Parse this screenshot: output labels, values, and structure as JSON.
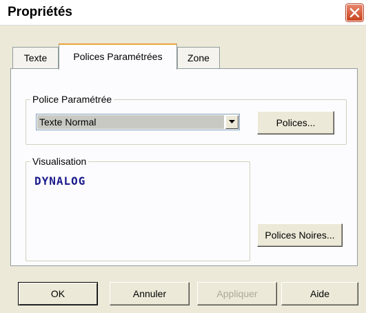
{
  "window": {
    "title": "Propriétés"
  },
  "tabs": [
    {
      "label": "Texte",
      "selected": false
    },
    {
      "label": "Polices Paramétrées",
      "selected": true
    },
    {
      "label": "Zone",
      "selected": false
    }
  ],
  "police_group": {
    "legend": "Police Paramétrée",
    "combo_value": "Texte Normal",
    "polices_button": "Polices..."
  },
  "visualisation_group": {
    "legend": "Visualisation",
    "preview_text": "DYNALOG",
    "preview_color": "#1a1a8c"
  },
  "polices_noires_button": "Polices Noires...",
  "footer": {
    "ok": "OK",
    "annuler": "Annuler",
    "appliquer": "Appliquer",
    "aide": "Aide"
  },
  "colors": {
    "dialog_bg": "#ece9d8",
    "close_button": "#c9441f",
    "active_tab_highlight": "#e8a33d"
  }
}
